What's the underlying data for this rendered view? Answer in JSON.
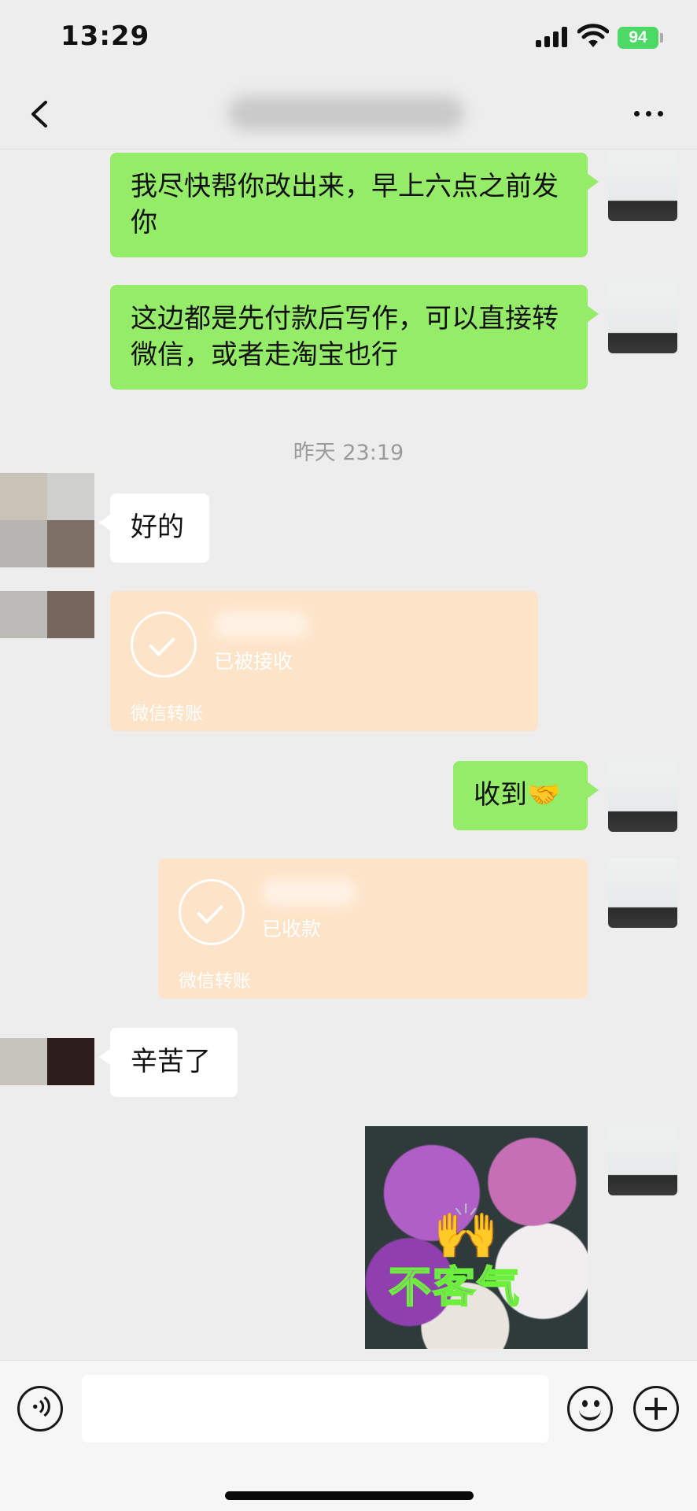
{
  "status_bar": {
    "time": "13:29",
    "battery": "94"
  },
  "nav": {
    "back_icon": "chevron-left-icon",
    "more_icon": "more-dots-icon"
  },
  "messages": [
    {
      "side": "right",
      "type": "text",
      "text": "我尽快帮你改出来，早上六点之前发你"
    },
    {
      "side": "right",
      "type": "text",
      "text": "这边都是先付款后写作，可以直接转微信，或者走淘宝也行"
    },
    {
      "type": "time",
      "text": "昨天 23:19"
    },
    {
      "side": "left",
      "type": "text",
      "text": "好的"
    },
    {
      "side": "left",
      "type": "transfer",
      "state": "已被接收",
      "label": "微信转账"
    },
    {
      "side": "right",
      "type": "text",
      "text": "收到🤝"
    },
    {
      "side": "right",
      "type": "transfer",
      "state": "已收款",
      "label": "微信转账"
    },
    {
      "side": "left",
      "type": "text",
      "text": "辛苦了"
    },
    {
      "side": "right",
      "type": "sticker",
      "text": "不客气",
      "hands": "🙌"
    }
  ],
  "input_bar": {
    "placeholder": "",
    "voice_icon": "voice-icon",
    "emoji_icon": "emoji-icon",
    "plus_icon": "plus-icon"
  },
  "colors": {
    "background": "#ededed",
    "bubble_right": "#95ec69",
    "bubble_left": "#ffffff",
    "transfer": "#fde3c8",
    "battery": "#4cd964"
  }
}
